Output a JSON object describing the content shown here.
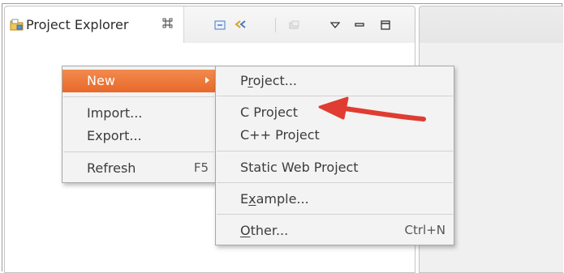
{
  "view": {
    "tab_title": "Project Explorer",
    "tab_close_glyph": "⌘",
    "toolbar_icons": [
      "collapse-all-icon",
      "link-with-editor-icon",
      "disabled-icon",
      "view-menu-icon",
      "minimize-icon",
      "maximize-icon"
    ]
  },
  "context_menu": {
    "items": [
      {
        "label": "New",
        "selected": true,
        "submenu": true
      },
      {
        "label": "Import..."
      },
      {
        "label": "Export..."
      },
      {
        "label": "Refresh",
        "accelerator": "F5"
      }
    ]
  },
  "submenu": {
    "items": [
      {
        "label_pre": "P",
        "label_mn": "r",
        "label_post": "oject..."
      },
      {
        "label": "C Project"
      },
      {
        "label": "C++ Project"
      },
      {
        "label": "Static Web Project"
      },
      {
        "label_pre": "E",
        "label_mn": "x",
        "label_post": "ample..."
      },
      {
        "label_pre": "",
        "label_mn": "O",
        "label_post": "ther...",
        "accelerator": "Ctrl+N"
      }
    ]
  },
  "colors": {
    "selection": "#ec7535",
    "arrow": "#e03c31"
  }
}
